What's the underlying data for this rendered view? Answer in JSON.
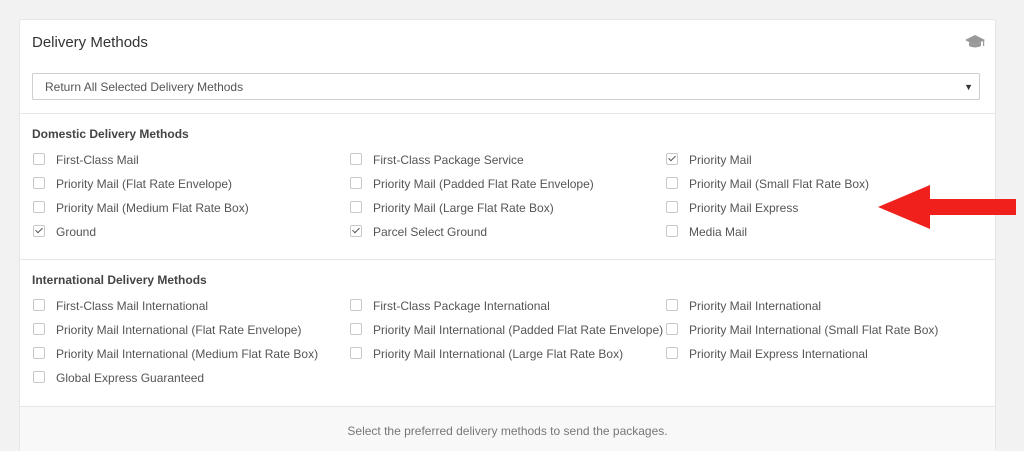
{
  "panel": {
    "title": "Delivery Methods",
    "help_icon": "graduation-cap-icon"
  },
  "select": {
    "value": "Return All Selected Delivery Methods"
  },
  "domestic": {
    "title": "Domestic Delivery Methods",
    "options": [
      {
        "label": "First-Class Mail",
        "checked": false
      },
      {
        "label": "First-Class Package Service",
        "checked": false
      },
      {
        "label": "Priority Mail",
        "checked": true
      },
      {
        "label": "Priority Mail (Flat Rate Envelope)",
        "checked": false
      },
      {
        "label": "Priority Mail (Padded Flat Rate Envelope)",
        "checked": false
      },
      {
        "label": "Priority Mail (Small Flat Rate Box)",
        "checked": false
      },
      {
        "label": "Priority Mail (Medium Flat Rate Box)",
        "checked": false
      },
      {
        "label": "Priority Mail (Large Flat Rate Box)",
        "checked": false
      },
      {
        "label": "Priority Mail Express",
        "checked": false
      },
      {
        "label": "Ground",
        "checked": true
      },
      {
        "label": "Parcel Select Ground",
        "checked": true
      },
      {
        "label": "Media Mail",
        "checked": false
      }
    ]
  },
  "international": {
    "title": "International Delivery Methods",
    "options": [
      {
        "label": "First-Class Mail International",
        "checked": false
      },
      {
        "label": "First-Class Package International",
        "checked": false
      },
      {
        "label": "Priority Mail International",
        "checked": false
      },
      {
        "label": "Priority Mail International (Flat Rate Envelope)",
        "checked": false
      },
      {
        "label": "Priority Mail International (Padded Flat Rate Envelope)",
        "checked": false
      },
      {
        "label": "Priority Mail International (Small Flat Rate Box)",
        "checked": false
      },
      {
        "label": "Priority Mail International (Medium Flat Rate Box)",
        "checked": false
      },
      {
        "label": "Priority Mail International (Large Flat Rate Box)",
        "checked": false
      },
      {
        "label": "Priority Mail Express International",
        "checked": false
      },
      {
        "label": "Global Express Guaranteed",
        "checked": false
      }
    ]
  },
  "footer": {
    "hint": "Select the preferred delivery methods to send the packages."
  },
  "annotation": {
    "arrow_color": "#f0211d"
  }
}
